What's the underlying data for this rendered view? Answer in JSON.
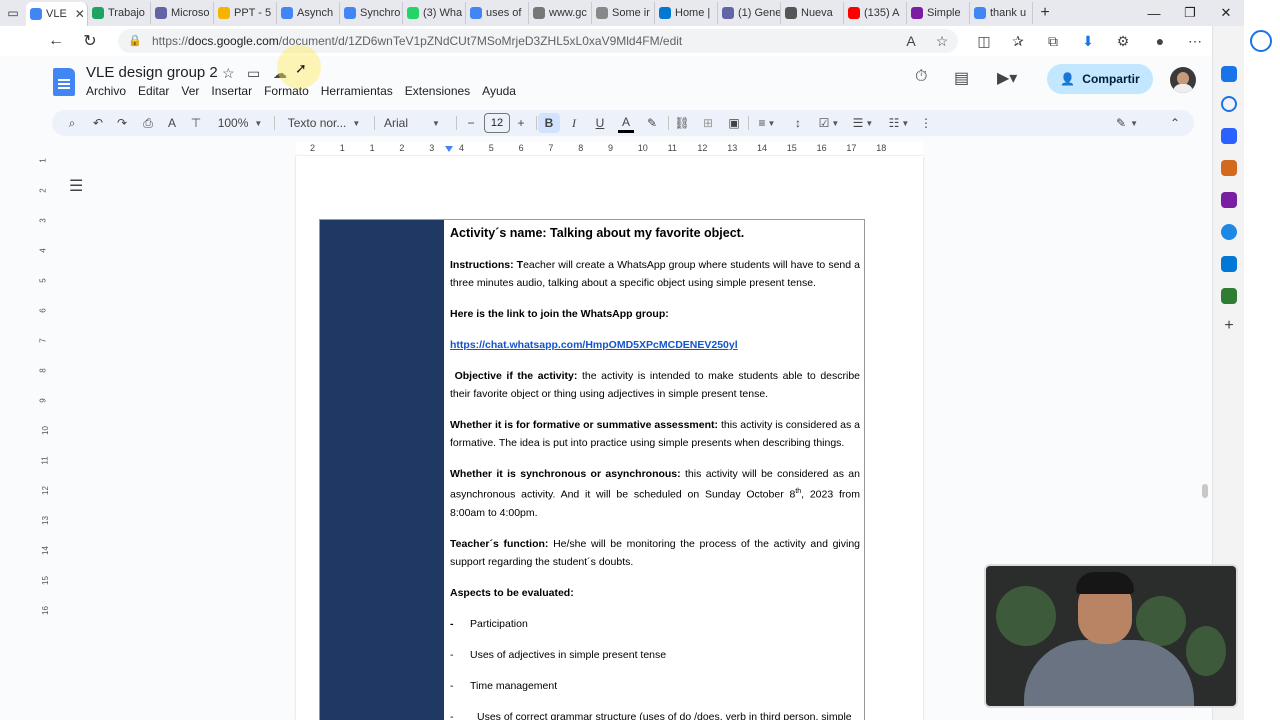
{
  "browser": {
    "tabs": [
      {
        "label": "VLE",
        "color": "#4285f4",
        "active": true
      },
      {
        "label": "Trabajo",
        "color": "#1ea362"
      },
      {
        "label": "Microso",
        "color": "#6264a7"
      },
      {
        "label": "PPT - 5",
        "color": "#f4b400"
      },
      {
        "label": "Asynch",
        "color": "#4285f4"
      },
      {
        "label": "Synchro",
        "color": "#4285f4"
      },
      {
        "label": "(3) Wha",
        "color": "#25d366"
      },
      {
        "label": "uses of",
        "color": "#4285f4"
      },
      {
        "label": "www.gc",
        "color": "#777777"
      },
      {
        "label": "Some ir",
        "color": "#888888"
      },
      {
        "label": "Home |",
        "color": "#0078d4"
      },
      {
        "label": "(1) Gene",
        "color": "#6264a7"
      },
      {
        "label": "Nueva",
        "color": "#555555"
      },
      {
        "label": "(135) A",
        "color": "#ff0000"
      },
      {
        "label": "Simple",
        "color": "#7b1fa2"
      },
      {
        "label": "thank u",
        "color": "#4285f4"
      }
    ],
    "url_prefix": "https://",
    "url_domain": "docs.google.com",
    "url_path": "/document/d/1ZD6wnTeV1pZNdCUt7MSoMrjeD3ZHL5xL0xaV9Mld4FM/edit"
  },
  "docs": {
    "title": "VLE design group 2",
    "menu": [
      "Archivo",
      "Editar",
      "Ver",
      "Insertar",
      "Formato",
      "Herramientas",
      "Extensiones",
      "Ayuda"
    ],
    "share_label": "Compartir",
    "toolbar": {
      "zoom": "100%",
      "style": "Texto nor...",
      "font": "Arial",
      "font_size": "12"
    }
  },
  "ruler": {
    "h_ticks": [
      "2",
      "1",
      "1",
      "2",
      "3",
      "4",
      "5",
      "6",
      "7",
      "8",
      "9",
      "10",
      "11",
      "12",
      "13",
      "14",
      "15",
      "16",
      "17",
      "18"
    ],
    "v_ticks": [
      "1",
      "2",
      "3",
      "4",
      "5",
      "6",
      "7",
      "8",
      "9",
      "10",
      "11",
      "12",
      "13",
      "14",
      "15",
      "16"
    ]
  },
  "document": {
    "activity_title": "Activity´s name: Talking about my favorite object.",
    "instructions_label": "Instructions:",
    "instructions_first": "T",
    "instructions_text": "eacher will create a WhatsApp group where students will have to send a three minutes audio, talking about a specific object using simple present tense.",
    "link_label": "Here is the link to join the WhatsApp group:",
    "link_url": "https://chat.whatsapp.com/HmpOMD5XPcMCDENEV250yl",
    "objective_label": "Objective if the activity:",
    "objective_text": "the activity is intended to make students able to describe their favorite object or thing using adjectives in simple present tense.",
    "assessment_label": "Whether it is for formative or summative assessment:",
    "assessment_text": "this activity is considered as a formative. The idea is put into practice using simple presents when describing things.",
    "sync_label": "Whether it is synchronous or asynchronous:",
    "sync_text_1": "this activity will be considered as an asynchronous activity. And it will be scheduled on Sunday October 8",
    "sync_sup": "th",
    "sync_text_2": ", 2023 from 8:00am to 4:00pm.",
    "teacher_label": "Teacher´s function:",
    "teacher_text": "He/she will be monitoring the process of the activity and giving support regarding the student´s doubts.",
    "aspects_label": "Aspects to be evaluated:",
    "aspects": [
      {
        "dash": "-",
        "text": "Participation"
      },
      {
        "dash": "-",
        "text": "Uses of adjectives in simple present tense"
      },
      {
        "dash": "-",
        "text": "Time management"
      },
      {
        "dash": "-",
        "text": "Uses of correct grammar structure (uses of do /does, verb in third person, simple"
      }
    ]
  },
  "colors": {
    "table_blue": "#1f3864",
    "share_bg": "#c2e7ff",
    "link": "#1155cc"
  }
}
